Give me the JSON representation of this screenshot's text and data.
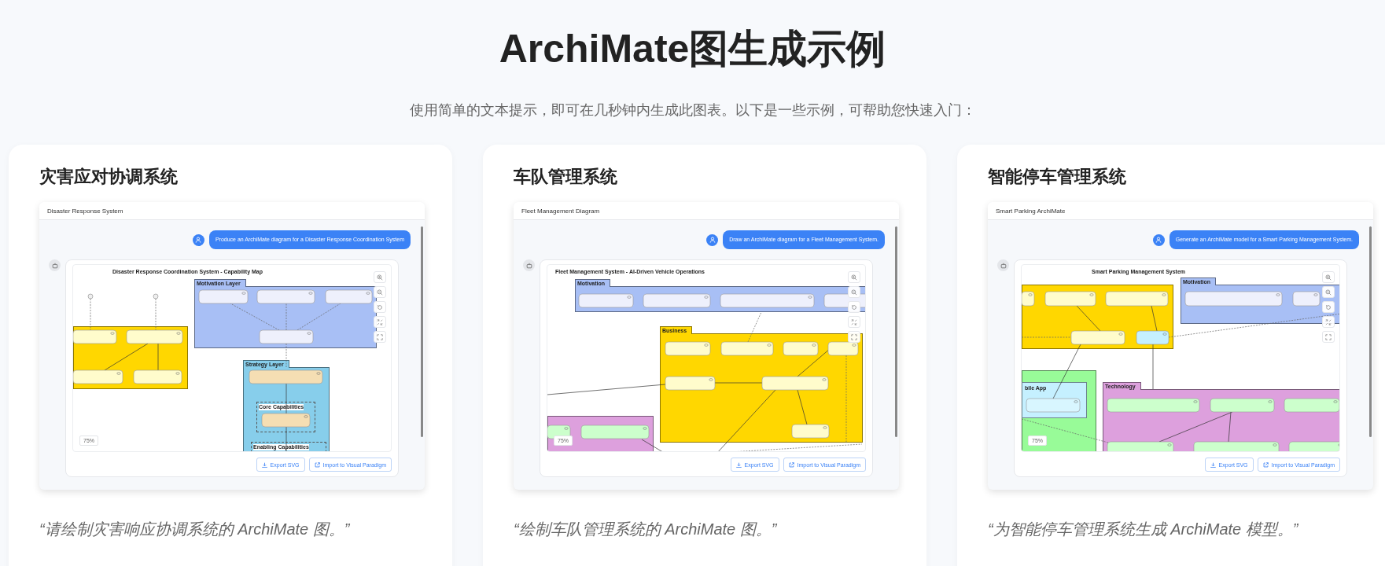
{
  "header": {
    "title": "ArchiMate图生成示例",
    "subtitle": "使用简单的文本提示，即可在几秒钟内生成此图表。以下是一些示例，可帮助您快速入门："
  },
  "examples": [
    {
      "title": "灾害应对协调系统",
      "screenshot": {
        "window_title": "Disaster Response System",
        "prompt": "Produce an ArchiMate diagram for a Disaster Response Coordination System",
        "zoom": "75%",
        "buttons": [
          {
            "kind": "export",
            "label": "Export SVG"
          },
          {
            "kind": "import",
            "label": "Import to Visual Paradigm"
          }
        ],
        "diagram": {
          "title": "Disaster Response Coordination System - Capability Map",
          "groups": [
            {
              "label": "Motivation Layer",
              "color": "#a8bff5"
            },
            {
              "label": "Strategy Layer",
              "color": "#87ceeb"
            },
            {
              "label": "Core Capabilities"
            },
            {
              "label": "Enabling Capabilities"
            }
          ]
        }
      },
      "caption": "“请绘制灾害响应协调系统的 ArchiMate 图。”"
    },
    {
      "title": "车队管理系统",
      "screenshot": {
        "window_title": "Fleet Management Diagram",
        "prompt": "Draw an ArchiMate diagram for a Fleet Management System.",
        "zoom": "75%",
        "buttons": [
          {
            "kind": "export",
            "label": "Export SVG"
          },
          {
            "kind": "import",
            "label": "Import to Visual Paradigm"
          }
        ],
        "diagram": {
          "title": "Fleet Management System - AI-Driven Vehicle Operations",
          "groups": [
            {
              "label": "Motivation",
              "color": "#a8bff5"
            },
            {
              "label": "Business",
              "color": "#ffd700"
            }
          ]
        }
      },
      "caption": "“绘制车队管理系统的 ArchiMate 图。”"
    },
    {
      "title": "智能停车管理系统",
      "screenshot": {
        "window_title": "Smart Parking ArchiMate",
        "prompt": "Generate an ArchiMate model for a Smart Parking Management System.",
        "zoom": "75%",
        "buttons": [
          {
            "kind": "export",
            "label": "Export SVG"
          },
          {
            "kind": "import",
            "label": "Import to Visual Paradigm"
          }
        ],
        "diagram": {
          "title": "Smart Parking Management System",
          "groups": [
            {
              "label": "Motivation",
              "color": "#a8bff5"
            },
            {
              "label": "bile App",
              "color": "#c5f0ff"
            },
            {
              "label": "Technology",
              "color": "#dda0dd"
            }
          ]
        }
      },
      "caption": "“为智能停车管理系统生成 ArchiMate 模型。”"
    }
  ]
}
